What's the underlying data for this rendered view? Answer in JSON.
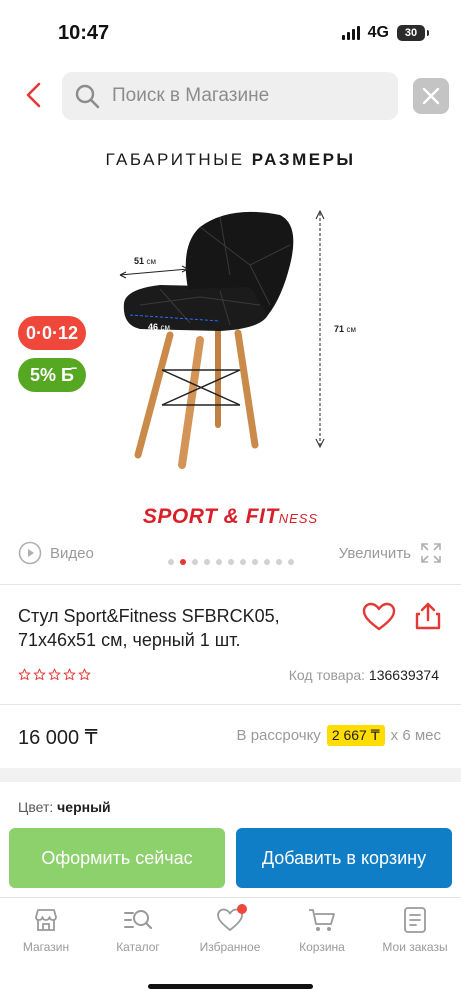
{
  "status_bar": {
    "time": "10:47",
    "network": "4G",
    "battery": "30"
  },
  "header": {
    "search_placeholder": "Поиск в Магазине"
  },
  "gallery": {
    "title_regular": "ГАБАРИТНЫЕ ",
    "title_bold": "РАЗМЕРЫ",
    "dims": {
      "width_value": "51",
      "depth_value": "46",
      "height_value": "71",
      "unit": "см"
    },
    "brand_main": "SPORT & FIT",
    "brand_tail": "NESS",
    "installment_badge": "0·0·12",
    "bonus_badge": "5% Б̄",
    "video_label": "Видео",
    "zoom_label": "Увеличить",
    "slide_count": 11,
    "active_slide": 1
  },
  "product": {
    "title": "Стул Sport&Fitness SFBRCK05, 71x46x51 см, черный 1 шт.",
    "code_label": "Код товара:",
    "code_value": "136639374",
    "rating": 0,
    "price": "16 000 ₸",
    "installment_label": "В рассрочку",
    "installment_amount": "2 667 ₸",
    "installment_term": "х 6 мес",
    "color_label": "Цвет:",
    "color_value": "черный"
  },
  "actions": {
    "buy_now": "Оформить сейчас",
    "add_to_cart": "Добавить в корзину"
  },
  "tabbar": {
    "items": [
      {
        "label": "Магазин",
        "icon": "shop-icon"
      },
      {
        "label": "Каталог",
        "icon": "catalog-search-icon"
      },
      {
        "label": "Избранное",
        "icon": "heart-icon"
      },
      {
        "label": "Корзина",
        "icon": "cart-icon"
      },
      {
        "label": "Мои заказы",
        "icon": "orders-icon"
      }
    ]
  },
  "colors": {
    "accent_red": "#f0473b",
    "green": "#8dd16d",
    "blue": "#0f7ec7",
    "installment_yellow": "#ffdd00"
  }
}
